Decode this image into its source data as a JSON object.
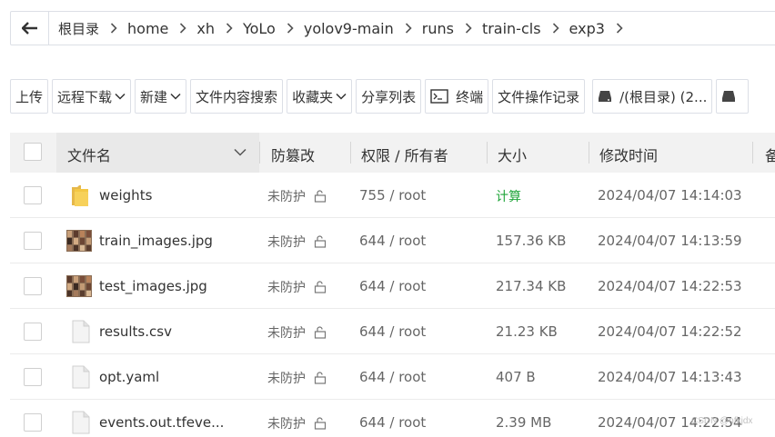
{
  "breadcrumb": {
    "items": [
      "根目录",
      "home",
      "xh",
      "YoLo",
      "yolov9-main",
      "runs",
      "train-cls",
      "exp3"
    ]
  },
  "toolbar": {
    "upload": "上传",
    "remote_download": "远程下载",
    "new": "新建",
    "content_search": "文件内容搜索",
    "favorites": "收藏夹",
    "share_list": "分享列表",
    "terminal": "终端",
    "operation_log": "文件操作记录",
    "disk": "/(根目录) (2..."
  },
  "table": {
    "headers": {
      "name": "文件名",
      "protect": "防篡改",
      "perm": "权限 / 所有者",
      "size": "大小",
      "mtime": "修改时间",
      "note": "备"
    },
    "rows": [
      {
        "name": "weights",
        "type": "folder",
        "protect": "未防护",
        "perm": "755 / root",
        "size": "计算",
        "mtime": "2024/04/07 14:14:03"
      },
      {
        "name": "train_images.jpg",
        "type": "image",
        "protect": "未防护",
        "perm": "644 / root",
        "size": "157.36 KB",
        "mtime": "2024/04/07 14:13:59"
      },
      {
        "name": "test_images.jpg",
        "type": "image",
        "protect": "未防护",
        "perm": "644 / root",
        "size": "217.34 KB",
        "mtime": "2024/04/07 14:22:53"
      },
      {
        "name": "results.csv",
        "type": "file",
        "protect": "未防护",
        "perm": "644 / root",
        "size": "21.23 KB",
        "mtime": "2024/04/07 14:22:52"
      },
      {
        "name": "opt.yaml",
        "type": "file",
        "protect": "未防护",
        "perm": "644 / root",
        "size": "407 B",
        "mtime": "2024/04/07 14:13:43"
      },
      {
        "name": "events.out.tfeve...",
        "type": "file",
        "protect": "未防护",
        "perm": "644 / root",
        "size": "2.39 MB",
        "mtime": "2024/04/07 14:22:54"
      }
    ]
  },
  "watermark": "CSDN @nfkjdx",
  "colors": {
    "accent_green": "#20a53a",
    "border": "#dcdfe6",
    "header_bg": "#f2f2f2"
  }
}
